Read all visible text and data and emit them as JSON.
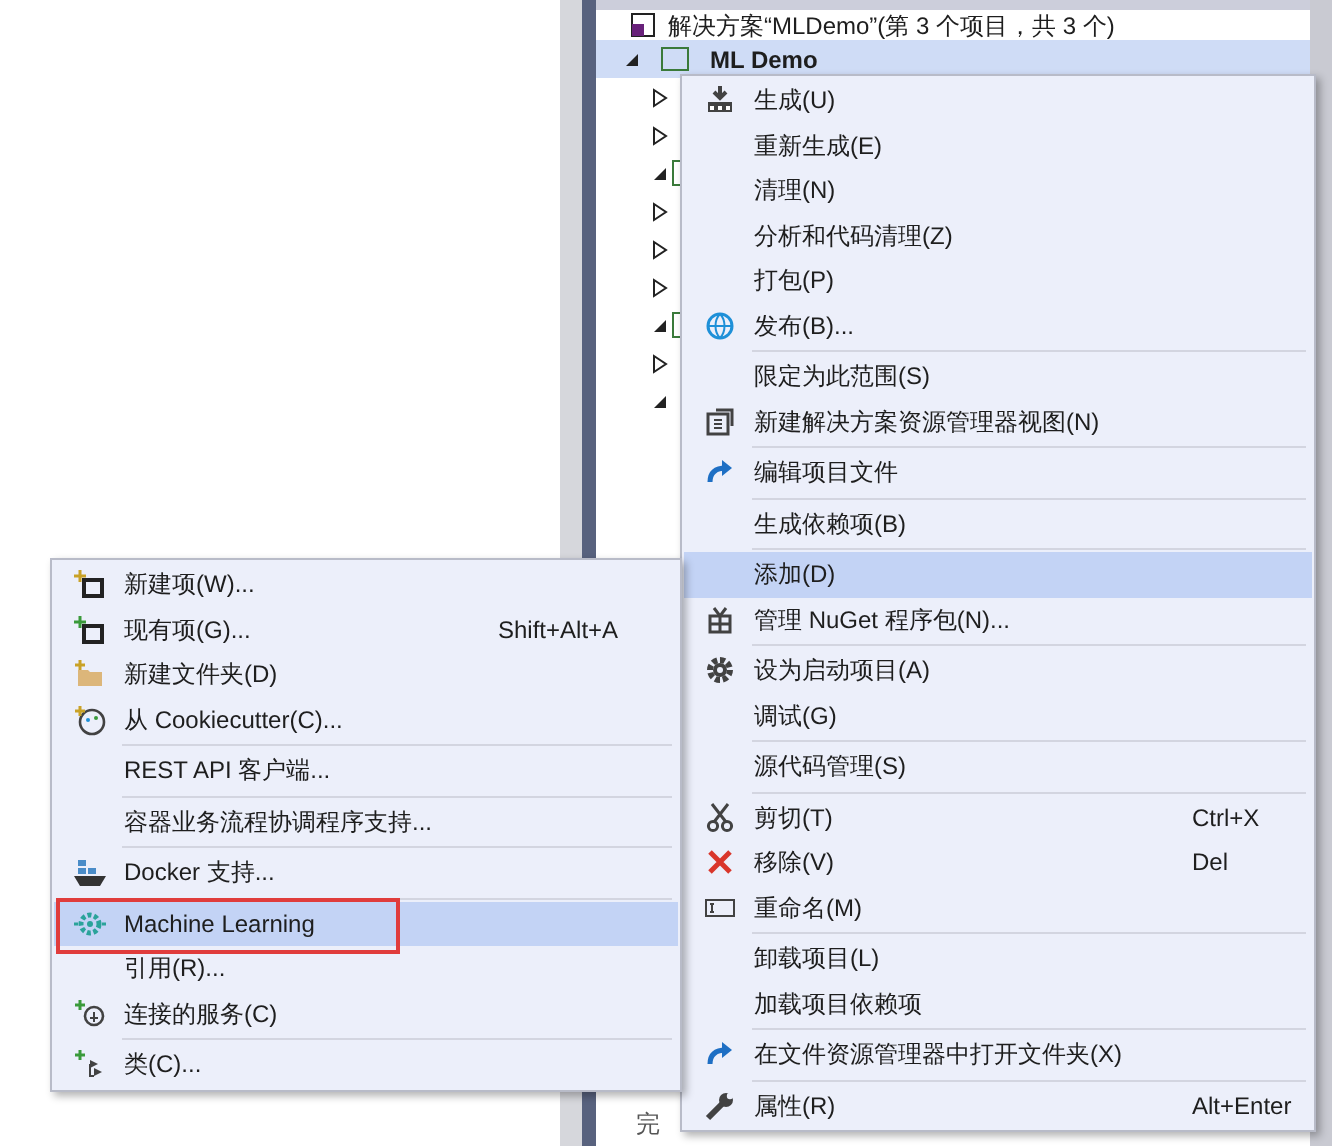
{
  "solution_explorer": {
    "solution_label": "解决方案“MLDemo”(第 3 个项目，共 3 个)",
    "project": {
      "name": "ML Demo",
      "selected": true,
      "expanded": true
    },
    "tree_rows": [
      {
        "kind": "folder",
        "expanded": false
      },
      {
        "kind": "folder",
        "expanded": false
      },
      {
        "kind": "project",
        "expanded": true
      },
      {
        "kind": "folder",
        "expanded": false
      },
      {
        "kind": "folder",
        "expanded": false
      },
      {
        "kind": "folder",
        "expanded": false
      },
      {
        "kind": "project",
        "expanded": true
      },
      {
        "kind": "folder",
        "expanded": false
      },
      {
        "kind": "folder",
        "expanded": true
      }
    ],
    "status": "完"
  },
  "context_menu": {
    "items": [
      {
        "kind": "build",
        "label": "生成(U)",
        "selected": false
      },
      {
        "label": "重新生成(E)",
        "selected": false
      },
      {
        "label": "清理(N)",
        "selected": false
      },
      {
        "label": "分析和代码清理(Z)",
        "selected": false
      },
      {
        "label": "打包(P)",
        "selected": false
      },
      {
        "kind": "globe",
        "label": "发布(B)...",
        "selected": false,
        "separator_after": true
      },
      {
        "label": "限定为此范围(S)",
        "selected": false
      },
      {
        "kind": "new-view",
        "label": "新建解决方案资源管理器视图(N)",
        "selected": false,
        "separator_after": true
      },
      {
        "kind": "redo",
        "label": "编辑项目文件",
        "selected": false,
        "separator_after": true
      },
      {
        "label": "生成依赖项(B)",
        "selected": false,
        "separator_after": true
      },
      {
        "label": "添加(D)",
        "selected": true
      },
      {
        "kind": "package",
        "label": "管理 NuGet 程序包(N)...",
        "selected": false,
        "separator_after": true
      },
      {
        "kind": "gear",
        "label": "设为启动项目(A)",
        "selected": false
      },
      {
        "label": "调试(G)",
        "selected": false,
        "separator_after": true
      },
      {
        "label": "源代码管理(S)",
        "selected": false,
        "separator_after": true
      },
      {
        "kind": "scissors",
        "label": "剪切(T)",
        "shortcut": "Ctrl+X",
        "selected": false
      },
      {
        "kind": "remove",
        "label": "移除(V)",
        "shortcut": "Del",
        "selected": false
      },
      {
        "kind": "rename",
        "label": "重命名(M)",
        "selected": false,
        "separator_after": true
      },
      {
        "label": "卸载项目(L)",
        "selected": false
      },
      {
        "label": "加载项目依赖项",
        "selected": false,
        "separator_after": true
      },
      {
        "kind": "redo",
        "label": "在文件资源管理器中打开文件夹(X)",
        "selected": false,
        "separator_after": true
      },
      {
        "kind": "wrench",
        "label": "属性(R)",
        "shortcut": "Alt+Enter",
        "selected": false
      }
    ]
  },
  "add_submenu": {
    "items": [
      {
        "kind": "new-item",
        "label": "新建项(W)...",
        "selected": false
      },
      {
        "kind": "existing-item",
        "label": "现有项(G)...",
        "shortcut": "Shift+Alt+A",
        "selected": false
      },
      {
        "kind": "new-folder",
        "label": "新建文件夹(D)",
        "selected": false
      },
      {
        "kind": "palette",
        "label": "从 Cookiecutter(C)...",
        "selected": false,
        "separator_after": true
      },
      {
        "label": "REST API 客户端...",
        "selected": false,
        "separator_after": true
      },
      {
        "label": "容器业务流程协调程序支持...",
        "selected": false,
        "separator_after": true
      },
      {
        "kind": "docker",
        "label": "Docker 支持...",
        "selected": false,
        "separator_after": true
      },
      {
        "kind": "ml",
        "label": "Machine Learning",
        "selected": true,
        "highlighted": true
      },
      {
        "label": "引用(R)...",
        "selected": false
      },
      {
        "kind": "connected",
        "label": "连接的服务(C)",
        "selected": false,
        "separator_after": true
      },
      {
        "kind": "class",
        "label": "类(C)...",
        "selected": false
      }
    ]
  }
}
